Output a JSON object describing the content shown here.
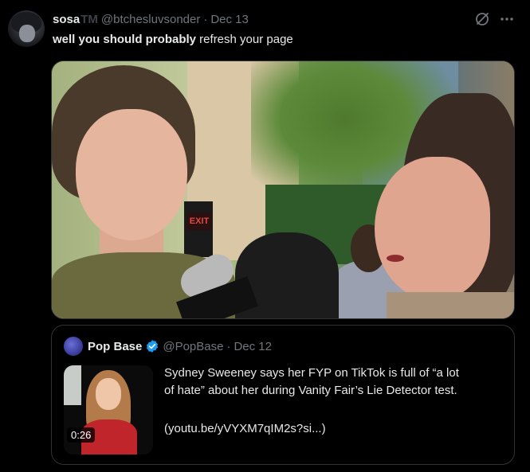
{
  "tweet": {
    "author_name": "sosa",
    "author_name_suffix": "TM",
    "handle": "@btchesluvsonder",
    "separator": "·",
    "date": "Dec 13",
    "text_bold": "well you should probably",
    "text_rest": " refresh your page",
    "actions": {
      "grok_icon": "grok-icon",
      "more_label": "···"
    }
  },
  "media": {
    "exit_sign": "EXIT"
  },
  "quote": {
    "author_name": "Pop Base",
    "verified_icon": "verified-badge-icon",
    "handle": "@PopBase",
    "separator": "·",
    "date": "Dec 12",
    "text_line1": "Sydney Sweeney says her FYP on TikTok is full of “a lot",
    "text_line2": "of hate” about her during Vanity Fair’s Lie Detector test.",
    "link": "(youtu.be/yVYXM7qIM2s?si...)",
    "video_duration": "0:26"
  },
  "colors": {
    "background": "#000000",
    "text_primary": "#e7e9ea",
    "text_secondary": "#71767b",
    "border": "#2f3336",
    "verified": "#1d9bf0"
  }
}
